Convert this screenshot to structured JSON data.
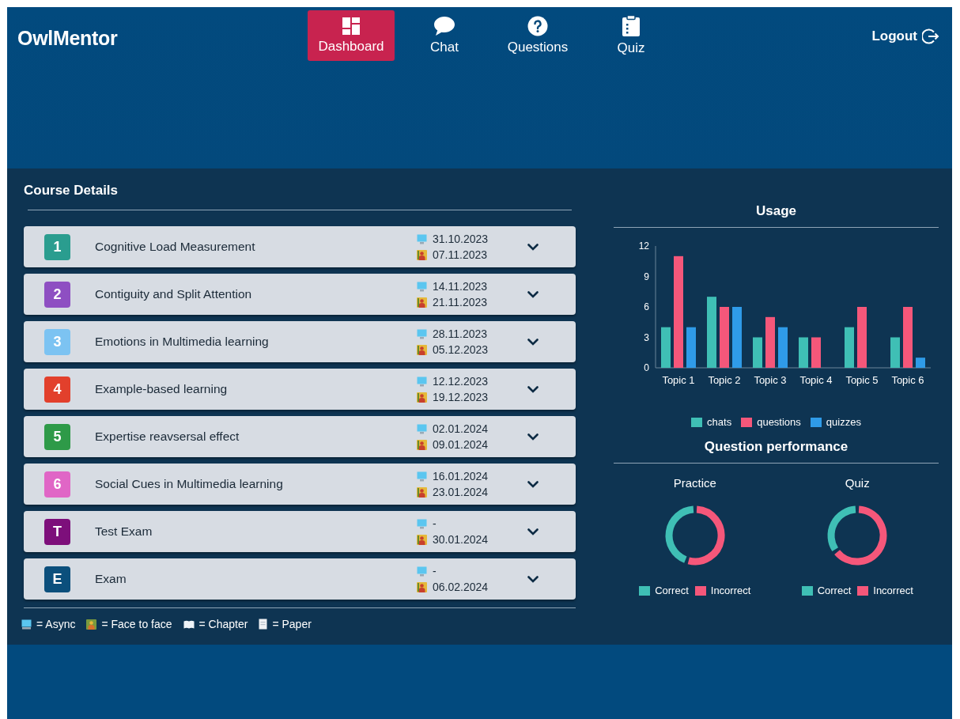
{
  "app": {
    "title": "OwlMentor"
  },
  "nav": [
    {
      "label": "Dashboard",
      "kind": "dashboard",
      "selected": true
    },
    {
      "label": "Chat",
      "kind": "chat",
      "selected": false
    },
    {
      "label": "Questions",
      "kind": "questions",
      "selected": false
    },
    {
      "label": "Quiz",
      "kind": "quiz",
      "selected": false
    }
  ],
  "logout": {
    "label": "Logout"
  },
  "course_details": {
    "title": "Course Details",
    "items": [
      {
        "badge": "1",
        "color": "#2a9d8f",
        "title": "Cognitive Load Measurement",
        "async_date": "31.10.2023",
        "face_to_face_date": "07.11.2023"
      },
      {
        "badge": "2",
        "color": "#8e4fc2",
        "title": "Contiguity and Split Attention",
        "async_date": "14.11.2023",
        "face_to_face_date": "21.11.2023"
      },
      {
        "badge": "3",
        "color": "#7cc3f2",
        "title": "Emotions in Multimedia learning",
        "async_date": "28.11.2023",
        "face_to_face_date": "05.12.2023"
      },
      {
        "badge": "4",
        "color": "#e2402c",
        "title": "Example-based learning",
        "async_date": "12.12.2023",
        "face_to_face_date": "19.12.2023"
      },
      {
        "badge": "5",
        "color": "#2e9a48",
        "title": "Expertise reavsersal effect",
        "async_date": "02.01.2024",
        "face_to_face_date": "09.01.2024"
      },
      {
        "badge": "6",
        "color": "#e066c6",
        "title": "Social Cues in Multimedia learning",
        "async_date": "16.01.2024",
        "face_to_face_date": "23.01.2024"
      },
      {
        "badge": "T",
        "color": "#7d0f7b",
        "title": "Test Exam",
        "async_date": "-",
        "face_to_face_date": "30.01.2024"
      },
      {
        "badge": "E",
        "color": "#0b4f7c",
        "title": "Exam",
        "async_date": "-",
        "face_to_face_date": "06.02.2024"
      }
    ]
  },
  "legend": [
    {
      "kind": "async",
      "label": "= Async"
    },
    {
      "kind": "face_to_face",
      "label": "= Face to face"
    },
    {
      "kind": "chapter",
      "label": "= Chapter"
    },
    {
      "kind": "paper",
      "label": "= Paper"
    }
  ],
  "usage": {
    "title": "Usage",
    "chart_data": {
      "type": "bar",
      "categories": [
        "Topic 1",
        "Topic 2",
        "Topic 3",
        "Topic 4",
        "Topic 5",
        "Topic 6"
      ],
      "series": [
        {
          "name": "chats",
          "color": "#3fbfb5",
          "values": [
            4,
            7,
            3,
            3,
            4,
            3
          ]
        },
        {
          "name": "questions",
          "color": "#f5577a",
          "values": [
            11,
            6,
            5,
            3,
            6,
            6
          ]
        },
        {
          "name": "quizzes",
          "color": "#2f9be8",
          "values": [
            4,
            6,
            4,
            0,
            0,
            1
          ]
        }
      ],
      "ylim": [
        0,
        12
      ],
      "yticks": [
        0,
        3,
        6,
        9,
        12
      ],
      "legend": "bottom"
    }
  },
  "question_performance": {
    "title": "Question performance",
    "charts": [
      {
        "title": "Practice",
        "legend": [
          {
            "label": "Correct",
            "color": "#3fbfb5"
          },
          {
            "label": "Incorrect",
            "color": "#f5577a"
          }
        ]
      },
      {
        "title": "Quiz",
        "legend": [
          {
            "label": "Correct",
            "color": "#3fbfb5"
          },
          {
            "label": "Incorrect",
            "color": "#f5577a"
          }
        ]
      }
    ]
  }
}
